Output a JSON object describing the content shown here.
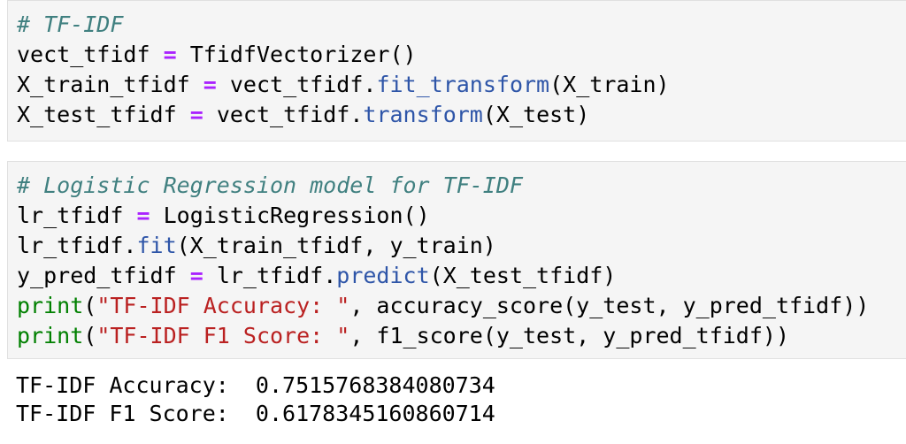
{
  "cell1": {
    "comment": "# TF-IDF",
    "line2": {
      "lhs": "vect_tfidf",
      "eq": "=",
      "rhs": "TfidfVectorizer()"
    },
    "line3": {
      "lhs": "X_train_tfidf",
      "eq": "=",
      "obj": "vect_tfidf.",
      "method": "fit_transform",
      "args": "(X_train)"
    },
    "line4": {
      "lhs": "X_test_tfidf",
      "eq": "=",
      "obj": "vect_tfidf.",
      "method": "transform",
      "args": "(X_test)"
    }
  },
  "cell2": {
    "comment": "# Logistic Regression model for TF-IDF",
    "line2": {
      "lhs": "lr_tfidf",
      "eq": "=",
      "rhs": "LogisticRegression()"
    },
    "line3": {
      "obj": "lr_tfidf.",
      "method": "fit",
      "args": "(X_train_tfidf, y_train)"
    },
    "line4": {
      "lhs": "y_pred_tfidf",
      "eq": "=",
      "obj": "lr_tfidf.",
      "method": "predict",
      "args": "(X_test_tfidf)"
    },
    "line5": {
      "fn": "print",
      "open": "(",
      "str": "\"TF-IDF Accuracy: \"",
      "rest": ", accuracy_score(y_test, y_pred_tfidf))"
    },
    "line6": {
      "fn": "print",
      "open": "(",
      "str": "\"TF-IDF F1 Score: \"",
      "rest": ", f1_score(y_test, y_pred_tfidf))"
    }
  },
  "output": {
    "line1": "TF-IDF Accuracy:  0.7515768384080734",
    "line2": "TF-IDF F1 Score:  0.6178345160860714"
  },
  "colors": {
    "comment": "#408080",
    "operator": "#aa22ff",
    "method": "#2e55a8",
    "builtin": "#008000",
    "string": "#ba2121",
    "cell_bg": "#f5f5f5"
  }
}
